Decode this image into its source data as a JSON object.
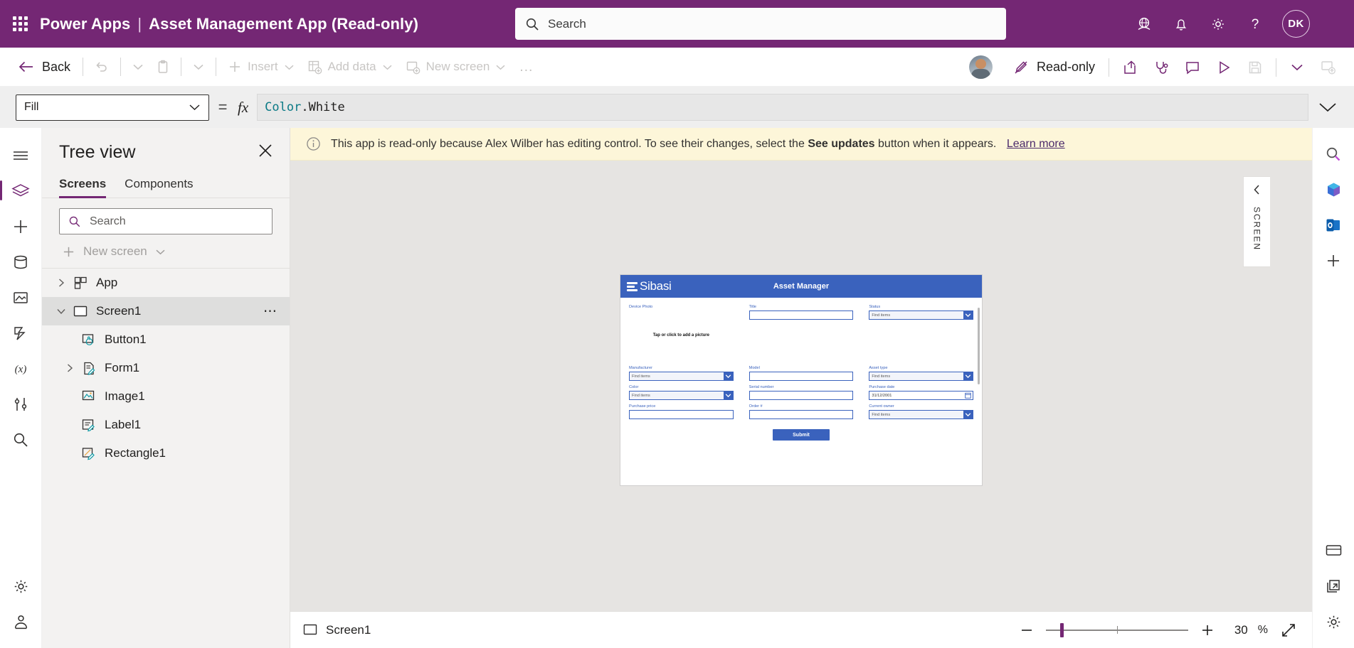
{
  "topbar": {
    "waffle_icon": "app-launcher-icon",
    "product": "Power Apps",
    "separator": "|",
    "app_title": "Asset Management App (Read-only)",
    "search_placeholder": "Search",
    "search_icon": "search-icon",
    "icons": [
      "environment-globe-icon",
      "notification-bell-icon",
      "settings-gear-icon",
      "help-question-icon"
    ],
    "avatar_initials": "DK",
    "accent": "#742774"
  },
  "commandbar": {
    "back": "Back",
    "undo_icon": "undo-icon",
    "undo_chevron": "chevron-down-icon",
    "paste_icon": "paste-icon",
    "paste_chevron": "chevron-down-icon",
    "insert": "Insert",
    "add_data": "Add data",
    "new_screen": "New screen",
    "overflow": "…",
    "collaborator_avatar": "user-photo-avatar",
    "readonly_label": "Read-only",
    "readonly_icon": "pen-slash-icon",
    "share_icon": "share-icon",
    "app_checker_icon": "stethoscope-icon",
    "comment_icon": "comment-icon",
    "preview_icon": "play-icon",
    "save_icon": "save-icon",
    "save_chevron": "chevron-down-icon",
    "publish_icon": "publish-icon"
  },
  "formulabar": {
    "property": "Fill",
    "property_chevron": "chevron-down-icon",
    "equals": "=",
    "fx": "fx",
    "formula_part1": "Color",
    "formula_part2": ".White",
    "expand_chevron": "chevron-down-icon"
  },
  "leftrail": {
    "items": [
      {
        "name": "hamburger-menu-icon"
      },
      {
        "name": "tree-view-layers-icon"
      },
      {
        "name": "insert-plus-icon"
      },
      {
        "name": "data-cylinder-icon"
      },
      {
        "name": "media-icon"
      },
      {
        "name": "power-automate-icon"
      },
      {
        "name": "variables-x-icon"
      },
      {
        "name": "advanced-tools-icon"
      },
      {
        "name": "search-icon"
      },
      {
        "name": "settings-gear-icon"
      },
      {
        "name": "app-checker-icon"
      }
    ]
  },
  "treeview": {
    "title": "Tree view",
    "close_icon": "close-icon",
    "tabs": [
      {
        "label": "Screens",
        "active": true
      },
      {
        "label": "Components",
        "active": false
      }
    ],
    "search_placeholder": "Search",
    "search_icon": "search-icon",
    "new_screen": "New screen",
    "new_screen_chevron": "chevron-down-icon",
    "items": [
      {
        "label": "App",
        "icon": "app-icon",
        "level": 0,
        "expandable": true,
        "expanded": false,
        "selected": false
      },
      {
        "label": "Screen1",
        "icon": "screen-icon",
        "level": 0,
        "expandable": true,
        "expanded": true,
        "selected": true,
        "overflow": "⋯"
      },
      {
        "label": "Button1",
        "icon": "button-icon",
        "level": 1,
        "expandable": false,
        "selected": false
      },
      {
        "label": "Form1",
        "icon": "form-icon",
        "level": 1,
        "expandable": true,
        "expanded": false,
        "selected": false
      },
      {
        "label": "Image1",
        "icon": "image-icon",
        "level": 1,
        "expandable": false,
        "selected": false
      },
      {
        "label": "Label1",
        "icon": "label-icon",
        "level": 1,
        "expandable": false,
        "selected": false
      },
      {
        "label": "Rectangle1",
        "icon": "rectangle-icon",
        "level": 1,
        "expandable": false,
        "selected": false
      }
    ]
  },
  "banner": {
    "info_icon": "info-circle-icon",
    "text_before": "This app is read-only because Alex Wilber has editing control. To see their changes, select the",
    "bold": "See updates",
    "text_after": "button when it appears.",
    "link": "Learn more",
    "background": "#fdf6d9"
  },
  "canvas": {
    "app": {
      "logo_text": "Sibasi",
      "logo_icon": "sibasi-bars-logo",
      "title": "Asset Manager",
      "header_color": "#3a62bd",
      "fields": [
        {
          "label": "Device Photo",
          "type": "photo",
          "hint": "Tap or click to add a picture"
        },
        {
          "label": "Title",
          "type": "text",
          "value": ""
        },
        {
          "label": "Status",
          "type": "combo",
          "placeholder": "Find items"
        },
        {
          "label": "Manufacturer",
          "type": "combo",
          "placeholder": "Find items"
        },
        {
          "label": "Model",
          "type": "text",
          "value": ""
        },
        {
          "label": "Asset type",
          "type": "combo",
          "placeholder": "Find items"
        },
        {
          "label": "Color",
          "type": "combo",
          "placeholder": "Find items"
        },
        {
          "label": "Serial number",
          "type": "text",
          "value": ""
        },
        {
          "label": "Purchase date",
          "type": "date",
          "value": "31/12/2001"
        },
        {
          "label": "Purchase price",
          "type": "text",
          "value": ""
        },
        {
          "label": "Order #",
          "type": "text",
          "value": ""
        },
        {
          "label": "Current owner",
          "type": "combo",
          "placeholder": "Find items"
        }
      ],
      "submit_label": "Submit"
    },
    "collapse_tab": {
      "icon": "chevron-left-icon",
      "label": "SCREEN"
    }
  },
  "rightrail": {
    "items": [
      {
        "name": "search-icon"
      },
      {
        "name": "office-apps-icon"
      },
      {
        "name": "outlook-icon"
      },
      {
        "name": "plus-icon"
      },
      {
        "name": "teams-chat-icon"
      },
      {
        "name": "open-external-icon"
      },
      {
        "name": "settings-gear-icon"
      }
    ]
  },
  "statusbar": {
    "screen_icon": "screen-icon",
    "screen_name": "Screen1",
    "zoom_out_icon": "minus-icon",
    "zoom_in_icon": "plus-icon",
    "zoom_value": "30",
    "zoom_unit": "%",
    "fit_icon": "fit-screen-icon"
  }
}
